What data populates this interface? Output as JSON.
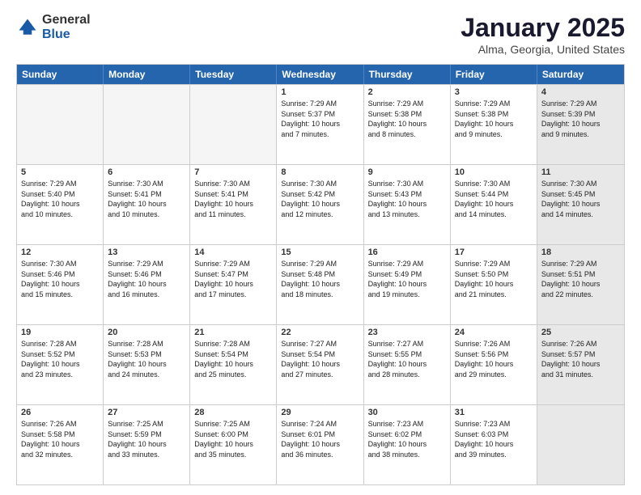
{
  "header": {
    "logo_general": "General",
    "logo_blue": "Blue",
    "title": "January 2025",
    "location": "Alma, Georgia, United States"
  },
  "days_of_week": [
    "Sunday",
    "Monday",
    "Tuesday",
    "Wednesday",
    "Thursday",
    "Friday",
    "Saturday"
  ],
  "weeks": [
    [
      {
        "num": "",
        "text": "",
        "empty": true
      },
      {
        "num": "",
        "text": "",
        "empty": true
      },
      {
        "num": "",
        "text": "",
        "empty": true
      },
      {
        "num": "1",
        "text": "Sunrise: 7:29 AM\nSunset: 5:37 PM\nDaylight: 10 hours\nand 7 minutes.",
        "empty": false
      },
      {
        "num": "2",
        "text": "Sunrise: 7:29 AM\nSunset: 5:38 PM\nDaylight: 10 hours\nand 8 minutes.",
        "empty": false
      },
      {
        "num": "3",
        "text": "Sunrise: 7:29 AM\nSunset: 5:38 PM\nDaylight: 10 hours\nand 9 minutes.",
        "empty": false
      },
      {
        "num": "4",
        "text": "Sunrise: 7:29 AM\nSunset: 5:39 PM\nDaylight: 10 hours\nand 9 minutes.",
        "empty": false,
        "shaded": true
      }
    ],
    [
      {
        "num": "5",
        "text": "Sunrise: 7:29 AM\nSunset: 5:40 PM\nDaylight: 10 hours\nand 10 minutes.",
        "empty": false
      },
      {
        "num": "6",
        "text": "Sunrise: 7:30 AM\nSunset: 5:41 PM\nDaylight: 10 hours\nand 10 minutes.",
        "empty": false
      },
      {
        "num": "7",
        "text": "Sunrise: 7:30 AM\nSunset: 5:41 PM\nDaylight: 10 hours\nand 11 minutes.",
        "empty": false
      },
      {
        "num": "8",
        "text": "Sunrise: 7:30 AM\nSunset: 5:42 PM\nDaylight: 10 hours\nand 12 minutes.",
        "empty": false
      },
      {
        "num": "9",
        "text": "Sunrise: 7:30 AM\nSunset: 5:43 PM\nDaylight: 10 hours\nand 13 minutes.",
        "empty": false
      },
      {
        "num": "10",
        "text": "Sunrise: 7:30 AM\nSunset: 5:44 PM\nDaylight: 10 hours\nand 14 minutes.",
        "empty": false
      },
      {
        "num": "11",
        "text": "Sunrise: 7:30 AM\nSunset: 5:45 PM\nDaylight: 10 hours\nand 14 minutes.",
        "empty": false,
        "shaded": true
      }
    ],
    [
      {
        "num": "12",
        "text": "Sunrise: 7:30 AM\nSunset: 5:46 PM\nDaylight: 10 hours\nand 15 minutes.",
        "empty": false
      },
      {
        "num": "13",
        "text": "Sunrise: 7:29 AM\nSunset: 5:46 PM\nDaylight: 10 hours\nand 16 minutes.",
        "empty": false
      },
      {
        "num": "14",
        "text": "Sunrise: 7:29 AM\nSunset: 5:47 PM\nDaylight: 10 hours\nand 17 minutes.",
        "empty": false
      },
      {
        "num": "15",
        "text": "Sunrise: 7:29 AM\nSunset: 5:48 PM\nDaylight: 10 hours\nand 18 minutes.",
        "empty": false
      },
      {
        "num": "16",
        "text": "Sunrise: 7:29 AM\nSunset: 5:49 PM\nDaylight: 10 hours\nand 19 minutes.",
        "empty": false
      },
      {
        "num": "17",
        "text": "Sunrise: 7:29 AM\nSunset: 5:50 PM\nDaylight: 10 hours\nand 21 minutes.",
        "empty": false
      },
      {
        "num": "18",
        "text": "Sunrise: 7:29 AM\nSunset: 5:51 PM\nDaylight: 10 hours\nand 22 minutes.",
        "empty": false,
        "shaded": true
      }
    ],
    [
      {
        "num": "19",
        "text": "Sunrise: 7:28 AM\nSunset: 5:52 PM\nDaylight: 10 hours\nand 23 minutes.",
        "empty": false
      },
      {
        "num": "20",
        "text": "Sunrise: 7:28 AM\nSunset: 5:53 PM\nDaylight: 10 hours\nand 24 minutes.",
        "empty": false
      },
      {
        "num": "21",
        "text": "Sunrise: 7:28 AM\nSunset: 5:54 PM\nDaylight: 10 hours\nand 25 minutes.",
        "empty": false
      },
      {
        "num": "22",
        "text": "Sunrise: 7:27 AM\nSunset: 5:54 PM\nDaylight: 10 hours\nand 27 minutes.",
        "empty": false
      },
      {
        "num": "23",
        "text": "Sunrise: 7:27 AM\nSunset: 5:55 PM\nDaylight: 10 hours\nand 28 minutes.",
        "empty": false
      },
      {
        "num": "24",
        "text": "Sunrise: 7:26 AM\nSunset: 5:56 PM\nDaylight: 10 hours\nand 29 minutes.",
        "empty": false
      },
      {
        "num": "25",
        "text": "Sunrise: 7:26 AM\nSunset: 5:57 PM\nDaylight: 10 hours\nand 31 minutes.",
        "empty": false,
        "shaded": true
      }
    ],
    [
      {
        "num": "26",
        "text": "Sunrise: 7:26 AM\nSunset: 5:58 PM\nDaylight: 10 hours\nand 32 minutes.",
        "empty": false
      },
      {
        "num": "27",
        "text": "Sunrise: 7:25 AM\nSunset: 5:59 PM\nDaylight: 10 hours\nand 33 minutes.",
        "empty": false
      },
      {
        "num": "28",
        "text": "Sunrise: 7:25 AM\nSunset: 6:00 PM\nDaylight: 10 hours\nand 35 minutes.",
        "empty": false
      },
      {
        "num": "29",
        "text": "Sunrise: 7:24 AM\nSunset: 6:01 PM\nDaylight: 10 hours\nand 36 minutes.",
        "empty": false
      },
      {
        "num": "30",
        "text": "Sunrise: 7:23 AM\nSunset: 6:02 PM\nDaylight: 10 hours\nand 38 minutes.",
        "empty": false
      },
      {
        "num": "31",
        "text": "Sunrise: 7:23 AM\nSunset: 6:03 PM\nDaylight: 10 hours\nand 39 minutes.",
        "empty": false
      },
      {
        "num": "",
        "text": "",
        "empty": true,
        "shaded": true
      }
    ]
  ]
}
